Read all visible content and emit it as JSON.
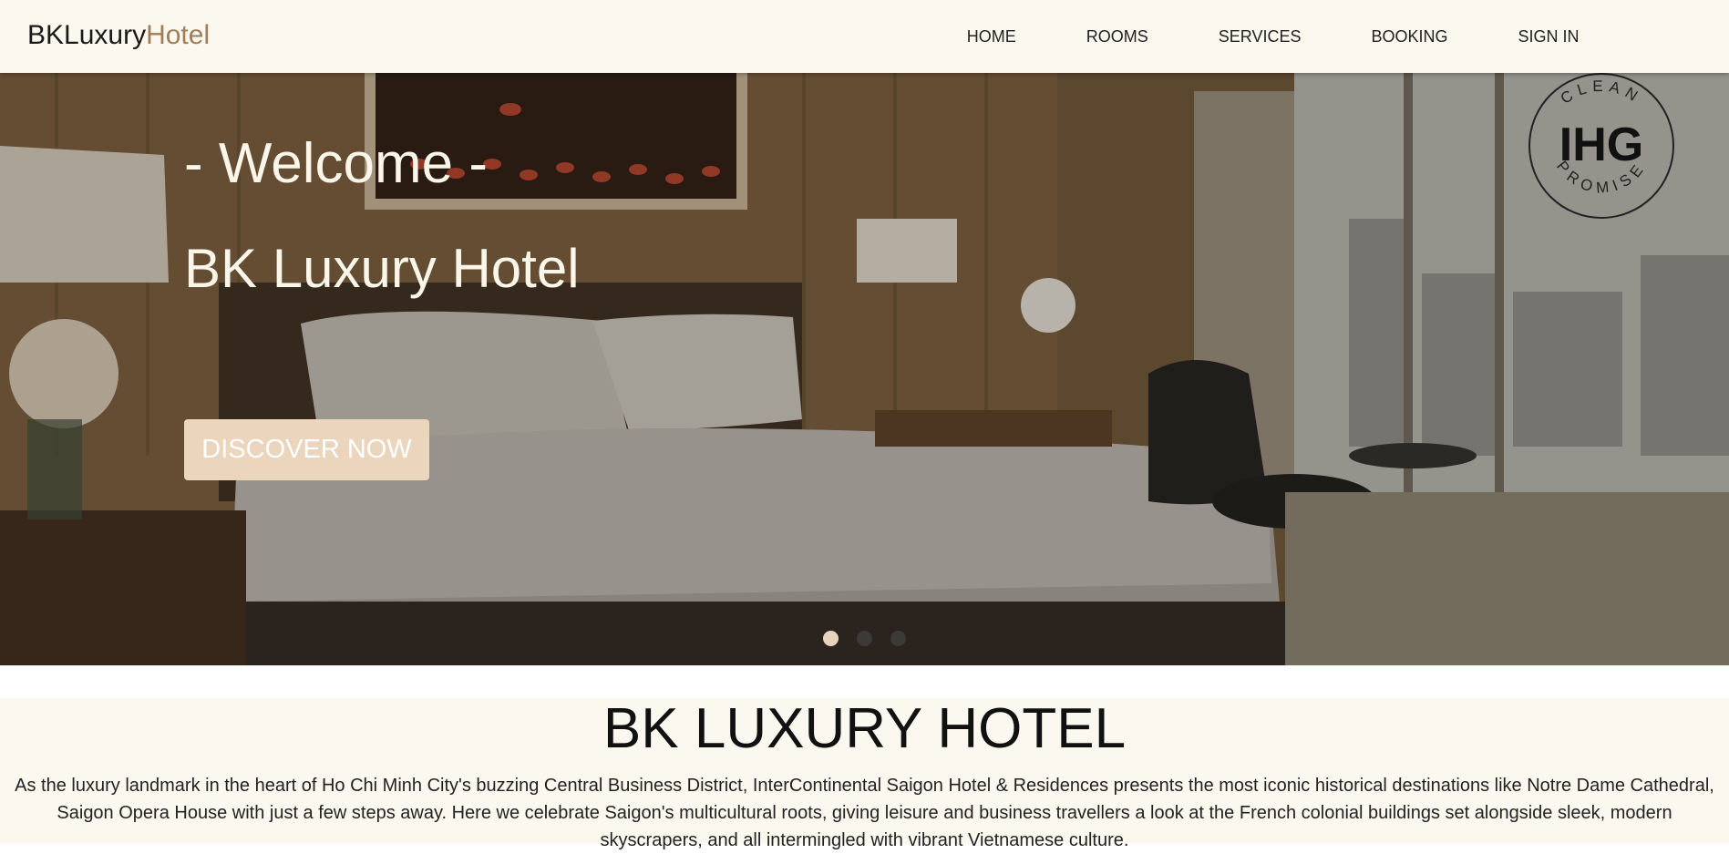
{
  "header": {
    "logo_primary": "BKLuxury",
    "logo_accent": "Hotel",
    "nav": [
      {
        "label": "HOME"
      },
      {
        "label": "ROOMS"
      },
      {
        "label": "SERVICES"
      },
      {
        "label": "BOOKING"
      },
      {
        "label": "SIGN IN"
      }
    ]
  },
  "hero": {
    "welcome": "- Welcome -",
    "hotel_name": "BK Luxury Hotel",
    "cta_label": "DISCOVER NOW",
    "slides_total": 3,
    "active_slide": 1,
    "badge": {
      "top_text": "CLEAN",
      "brand": "IHG",
      "bottom_text": "PROMISE"
    }
  },
  "about": {
    "title": "BK LUXURY HOTEL",
    "text": "As the luxury landmark in the heart of Ho Chi Minh City's buzzing Central Business District, InterContinental Saigon Hotel & Residences presents the most iconic historical destinations like Notre Dame Cathedral, Saigon Opera House with just a few steps away. Here we celebrate Saigon's multicultural roots, giving leisure and business travellers a look at the French colonial buildings set alongside sleek, modern skyscrapers, and all intermingled with vibrant Vietnamese culture."
  },
  "colors": {
    "header_bg": "#fbf8ef",
    "logo_accent": "#a07e58",
    "cta_bg": "#ecd5bd",
    "hero_text": "#fbf6ea"
  }
}
